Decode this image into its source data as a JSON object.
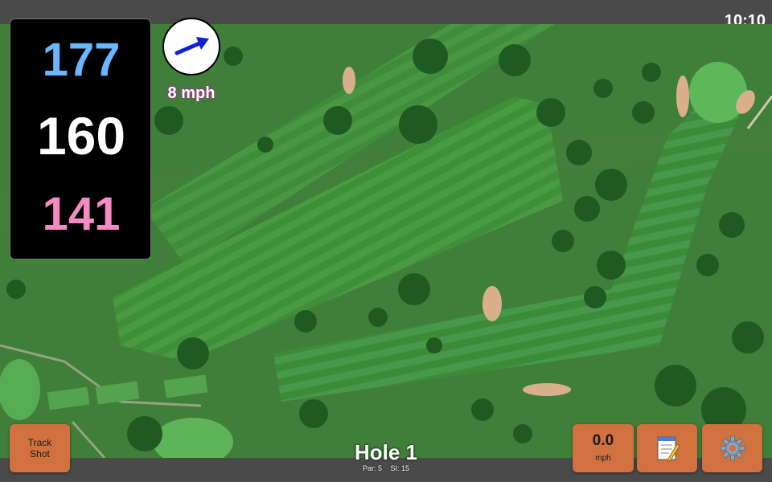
{
  "clock": "10:10",
  "distances": {
    "back": "177",
    "middle": "160",
    "front": "141"
  },
  "wind": {
    "speed": "8 mph",
    "icon": "wind-arrow-icon"
  },
  "buttons": {
    "track_shot": "Track\nShot",
    "speed_value": "0.0",
    "speed_unit": "mph",
    "notes_icon": "notepad-icon",
    "settings_icon": "gear-icon"
  },
  "hole": {
    "title": "Hole 1",
    "par": "Par: 5",
    "si": "SI: 15"
  },
  "colors": {
    "back_distance": "#6ab7ff",
    "middle_distance": "#ffffff",
    "front_distance": "#f58ac5",
    "button_bg": "#d0713f",
    "bar_bg": "#4a4a4a"
  }
}
